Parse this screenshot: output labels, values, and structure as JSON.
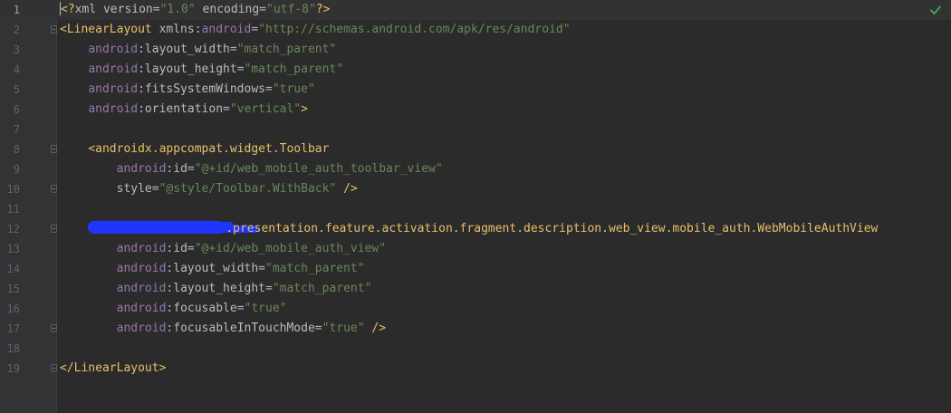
{
  "editor": {
    "lines": [
      {
        "n": "1",
        "indent": "",
        "t": [
          {
            "c": "caret"
          },
          {
            "c": "tag",
            "v": "<?"
          },
          {
            "c": "attr",
            "v": "xml version"
          },
          {
            "c": "plain",
            "v": "="
          },
          {
            "c": "val",
            "v": "\"1.0\""
          },
          {
            "c": "attr",
            "v": " encoding"
          },
          {
            "c": "plain",
            "v": "="
          },
          {
            "c": "val",
            "v": "\"utf-8\""
          },
          {
            "c": "tag",
            "v": "?>"
          }
        ]
      },
      {
        "n": "2",
        "indent": "",
        "t": [
          {
            "c": "tag",
            "v": "<LinearLayout "
          },
          {
            "c": "attr",
            "v": "xmlns:"
          },
          {
            "c": "ns",
            "v": "android"
          },
          {
            "c": "plain",
            "v": "="
          },
          {
            "c": "val",
            "v": "\"http://schemas.android.com/apk/res/android\""
          }
        ]
      },
      {
        "n": "3",
        "indent": "    ",
        "t": [
          {
            "c": "ns",
            "v": "android"
          },
          {
            "c": "attr",
            "v": ":layout_width"
          },
          {
            "c": "plain",
            "v": "="
          },
          {
            "c": "val",
            "v": "\"match_parent\""
          }
        ]
      },
      {
        "n": "4",
        "indent": "    ",
        "t": [
          {
            "c": "ns",
            "v": "android"
          },
          {
            "c": "attr",
            "v": ":layout_height"
          },
          {
            "c": "plain",
            "v": "="
          },
          {
            "c": "val",
            "v": "\"match_parent\""
          }
        ]
      },
      {
        "n": "5",
        "indent": "    ",
        "t": [
          {
            "c": "ns",
            "v": "android"
          },
          {
            "c": "attr",
            "v": ":fitsSystemWindows"
          },
          {
            "c": "plain",
            "v": "="
          },
          {
            "c": "val",
            "v": "\"true\""
          }
        ]
      },
      {
        "n": "6",
        "indent": "    ",
        "t": [
          {
            "c": "ns",
            "v": "android"
          },
          {
            "c": "attr",
            "v": ":orientation"
          },
          {
            "c": "plain",
            "v": "="
          },
          {
            "c": "val",
            "v": "\"vertical\""
          },
          {
            "c": "tag",
            "v": ">"
          }
        ]
      },
      {
        "n": "7",
        "indent": "",
        "t": []
      },
      {
        "n": "8",
        "indent": "    ",
        "t": [
          {
            "c": "tag",
            "v": "<androidx.appcompat.widget.Toolbar"
          }
        ]
      },
      {
        "n": "9",
        "indent": "        ",
        "t": [
          {
            "c": "ns",
            "v": "android"
          },
          {
            "c": "attr",
            "v": ":id"
          },
          {
            "c": "plain",
            "v": "="
          },
          {
            "c": "val",
            "v": "\"@+id/web_mobile_auth_toolbar_view\""
          }
        ]
      },
      {
        "n": "10",
        "indent": "        ",
        "t": [
          {
            "c": "attr",
            "v": "style"
          },
          {
            "c": "plain",
            "v": "="
          },
          {
            "c": "val",
            "v": "\"@style/Toolbar.WithBack\""
          },
          {
            "c": "tag",
            "v": " />"
          }
        ]
      },
      {
        "n": "11",
        "indent": "",
        "t": []
      },
      {
        "n": "12",
        "indent": "    ",
        "t": [
          {
            "c": "redact"
          },
          {
            "c": "tag",
            "v": ".presentation.feature.activation.fragment.description.web_view.mobile_auth.WebMobileAuthView"
          }
        ]
      },
      {
        "n": "13",
        "indent": "        ",
        "t": [
          {
            "c": "ns",
            "v": "android"
          },
          {
            "c": "attr",
            "v": ":id"
          },
          {
            "c": "plain",
            "v": "="
          },
          {
            "c": "val",
            "v": "\"@+id/web_mobile_auth_view\""
          }
        ]
      },
      {
        "n": "14",
        "indent": "        ",
        "t": [
          {
            "c": "ns",
            "v": "android"
          },
          {
            "c": "attr",
            "v": ":layout_width"
          },
          {
            "c": "plain",
            "v": "="
          },
          {
            "c": "val",
            "v": "\"match_parent\""
          }
        ]
      },
      {
        "n": "15",
        "indent": "        ",
        "t": [
          {
            "c": "ns",
            "v": "android"
          },
          {
            "c": "attr",
            "v": ":layout_height"
          },
          {
            "c": "plain",
            "v": "="
          },
          {
            "c": "val",
            "v": "\"match_parent\""
          }
        ]
      },
      {
        "n": "16",
        "indent": "        ",
        "t": [
          {
            "c": "ns",
            "v": "android"
          },
          {
            "c": "attr",
            "v": ":focusable"
          },
          {
            "c": "plain",
            "v": "="
          },
          {
            "c": "val",
            "v": "\"true\""
          }
        ]
      },
      {
        "n": "17",
        "indent": "        ",
        "t": [
          {
            "c": "ns",
            "v": "android"
          },
          {
            "c": "attr",
            "v": ":focusableInTouchMode"
          },
          {
            "c": "plain",
            "v": "="
          },
          {
            "c": "val",
            "v": "\"true\""
          },
          {
            "c": "tag",
            "v": " />"
          }
        ]
      },
      {
        "n": "18",
        "indent": "",
        "t": []
      },
      {
        "n": "19",
        "indent": "",
        "t": [
          {
            "c": "tag",
            "v": "</LinearLayout>"
          }
        ]
      }
    ]
  },
  "status": {
    "inspection": "ok",
    "icon": "check-icon",
    "color": "#499c54"
  }
}
